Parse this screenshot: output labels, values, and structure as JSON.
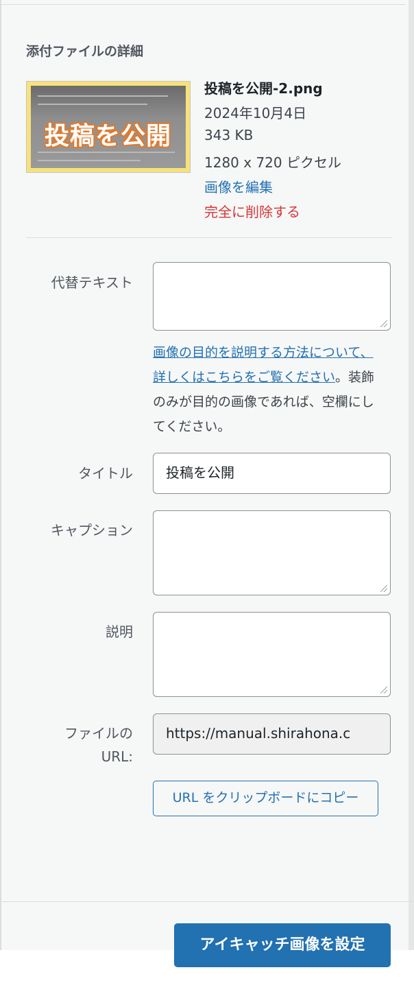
{
  "sidebar": {
    "heading": "添付ファイルの詳細",
    "thumbnail_text": "投稿を公開",
    "file": {
      "name": "投稿を公開-2.png",
      "date": "2024年10月4日",
      "size": "343 KB",
      "dimensions": "1280 x 720 ピクセル",
      "edit_link": "画像を編集",
      "delete_link": "完全に削除する"
    },
    "fields": {
      "alt_label": "代替テキスト",
      "alt_value": "",
      "help_link": "画像の目的を説明する方法について、詳しくはこちらをご覧ください",
      "help_text": "。装飾のみが目的の画像であれば、空欄にしてください。",
      "title_label": "タイトル",
      "title_value": "投稿を公開",
      "caption_label": "キャプション",
      "caption_value": "",
      "description_label": "説明",
      "description_value": "",
      "url_label_line1": "ファイルの",
      "url_label_line2": "URL:",
      "url_value": "https://manual.shirahona.c"
    },
    "copy_button": "URL をクリップボードにコピー"
  },
  "footer": {
    "set_featured_button": "アイキャッチ画像を設定"
  },
  "colors": {
    "accent": "#2271b1",
    "danger": "#d63638",
    "panel_bg": "#f6f7f7"
  }
}
